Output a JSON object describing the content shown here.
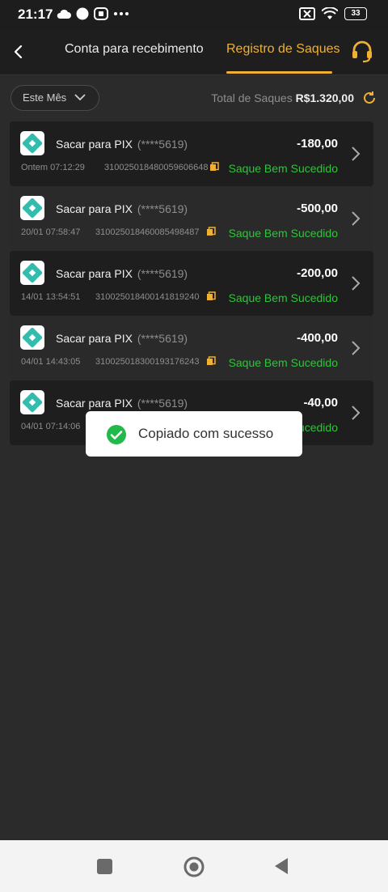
{
  "status_bar": {
    "time": "21:17",
    "battery": "33"
  },
  "header": {
    "tabs": [
      {
        "label": "Conta para recebimento"
      },
      {
        "label": "Registro de Saques"
      }
    ],
    "accent_color": "#f0b033"
  },
  "filter": {
    "label": "Este Mês"
  },
  "summary": {
    "label": "Total de Saques",
    "value": "R$1.320,00"
  },
  "records": [
    {
      "method": "Sacar para PIX",
      "account": "(****5619)",
      "amount": "-180,00",
      "date": "Ontem 07:12:29",
      "code": "310025018480059606648",
      "status": "Saque Bem Sucedido"
    },
    {
      "method": "Sacar para PIX",
      "account": "(****5619)",
      "amount": "-500,00",
      "date": "20/01 07:58:47",
      "code": "310025018460085498487",
      "status": "Saque Bem Sucedido"
    },
    {
      "method": "Sacar para PIX",
      "account": "(****5619)",
      "amount": "-200,00",
      "date": "14/01 13:54:51",
      "code": "310025018400141819240",
      "status": "Saque Bem Sucedido"
    },
    {
      "method": "Sacar para PIX",
      "account": "(****5619)",
      "amount": "-400,00",
      "date": "04/01 14:43:05",
      "code": "310025018300193176243",
      "status": "Saque Bem Sucedido"
    },
    {
      "method": "Sacar para PIX",
      "account": "(****5619)",
      "amount": "-40,00",
      "date": "04/01 07:14:06",
      "code": "",
      "status": "Sucedido"
    }
  ],
  "status_color": "#2ec43b",
  "toast": {
    "message": "Copiado com sucesso"
  }
}
